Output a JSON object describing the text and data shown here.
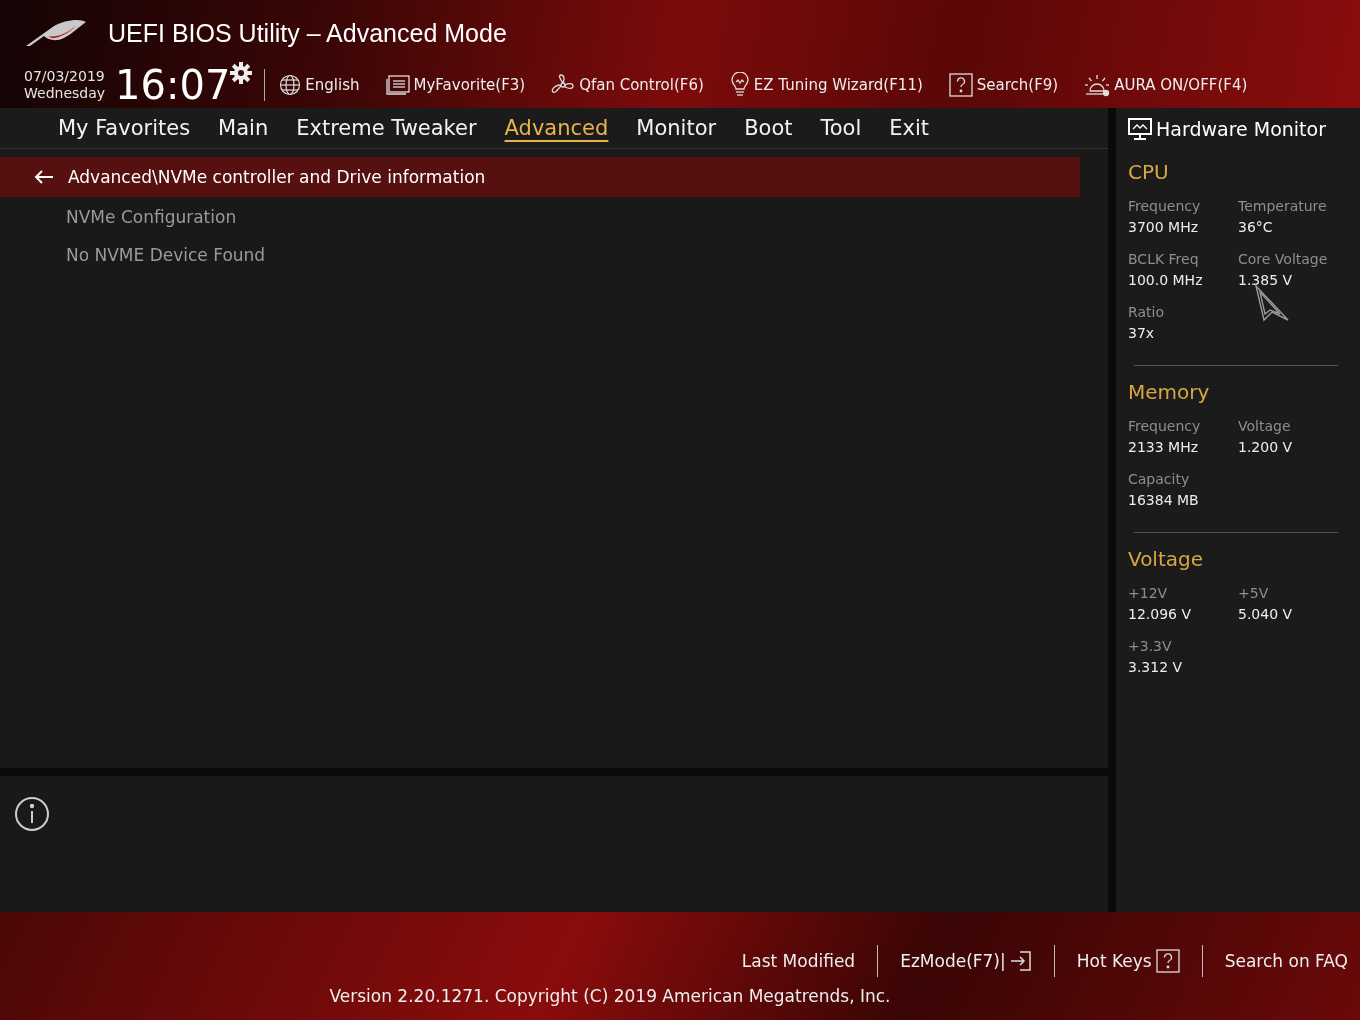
{
  "header": {
    "title": "UEFI BIOS Utility – Advanced Mode",
    "date": "07/03/2019",
    "day": "Wednesday",
    "time": "16:07",
    "toolbar": [
      {
        "label": "English",
        "kind": "globe"
      },
      {
        "label": "MyFavorite(F3)",
        "kind": "list"
      },
      {
        "label": "Qfan Control(F6)",
        "kind": "fan"
      },
      {
        "label": "EZ Tuning Wizard(F11)",
        "kind": "bulb"
      },
      {
        "label": "Search(F9)",
        "kind": "question"
      },
      {
        "label": "AURA ON/OFF(F4)",
        "kind": "aura"
      }
    ]
  },
  "tabs": [
    {
      "label": "My Favorites",
      "selected": false
    },
    {
      "label": "Main",
      "selected": false
    },
    {
      "label": "Extreme Tweaker",
      "selected": false
    },
    {
      "label": "Advanced",
      "selected": true
    },
    {
      "label": "Monitor",
      "selected": false
    },
    {
      "label": "Boot",
      "selected": false
    },
    {
      "label": "Tool",
      "selected": false
    },
    {
      "label": "Exit",
      "selected": false
    }
  ],
  "breadcrumb": "Advanced\\NVMe controller and Drive information",
  "items": [
    "NVMe Configuration",
    "No NVME Device Found"
  ],
  "hardware_monitor": {
    "title": "Hardware Monitor",
    "sections": [
      {
        "title": "CPU",
        "readings": [
          {
            "label": "Frequency",
            "value": "3700 MHz"
          },
          {
            "label": "Temperature",
            "value": "36°C"
          },
          {
            "label": "BCLK Freq",
            "value": "100.0 MHz"
          },
          {
            "label": "Core Voltage",
            "value": "1.385 V"
          },
          {
            "label": "Ratio",
            "value": "37x"
          }
        ]
      },
      {
        "title": "Memory",
        "readings": [
          {
            "label": "Frequency",
            "value": "2133 MHz"
          },
          {
            "label": "Voltage",
            "value": "1.200 V"
          },
          {
            "label": "Capacity",
            "value": "16384 MB"
          }
        ]
      },
      {
        "title": "Voltage",
        "readings": [
          {
            "label": "+12V",
            "value": "12.096 V"
          },
          {
            "label": "+5V",
            "value": "5.040 V"
          },
          {
            "label": "+3.3V",
            "value": "3.312 V"
          }
        ]
      }
    ]
  },
  "footer": {
    "links": [
      {
        "label": "Last Modified",
        "kind": "plain"
      },
      {
        "label": "EzMode(F7)|",
        "kind": "exit"
      },
      {
        "label": "Hot Keys",
        "kind": "question"
      },
      {
        "label": "Search on FAQ",
        "kind": "plain"
      }
    ],
    "version": "Version 2.20.1271. Copyright (C) 2019 American Megatrends, Inc."
  }
}
